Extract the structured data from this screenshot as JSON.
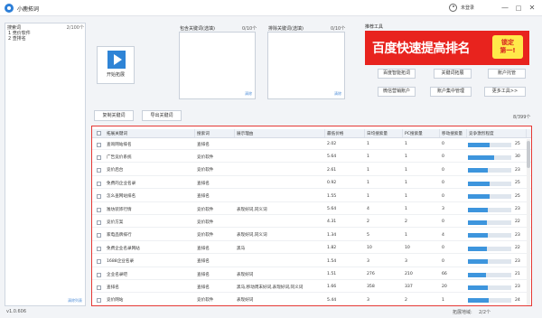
{
  "app": {
    "title": "小鹿拓词",
    "login_label": "未登录",
    "minimize_glyph": "—",
    "maximize_glyph": "□",
    "close_glyph": "✕"
  },
  "sidebar": {
    "title": "搜索词",
    "count": "2/100个",
    "items": [
      "1 竞价软件",
      "2 查排名"
    ],
    "clear_label": "清除列表"
  },
  "start_button": {
    "label": "开始拓展"
  },
  "include_kw": {
    "label": "包含关键词(选填)",
    "count": "0/10个",
    "clear_label": "清除"
  },
  "exclude_kw": {
    "label": "排除关键词(选填)",
    "count": "0/10个",
    "clear_label": "清除"
  },
  "tools": {
    "label": "推荐工具",
    "banner_text": "百度快速提高排名",
    "badge_line1": "锁定",
    "badge_line2": "第一!",
    "buttons": [
      "百度智能拓词",
      "关键词拓展",
      "账户托管",
      "微信营销账户",
      "账户集中管理",
      "更多工具>>"
    ]
  },
  "actions": {
    "copy_label": "复制关键词",
    "export_label": "导出关键词",
    "result_count": "8/399个"
  },
  "table": {
    "headers": [
      "拓展关键词",
      "搜索词",
      "展示理由",
      "最低价格",
      "日均搜索量",
      "PC搜索量",
      "移动搜索量",
      "竞争激烈程度"
    ],
    "rows": [
      {
        "kw": "查询网站排名",
        "src": "查排名",
        "reason": "",
        "price": "2.02",
        "daily": "1",
        "pc": "1",
        "mobile": "0",
        "comp": 25
      },
      {
        "kw": "广告竞价系统",
        "src": "竞价软件",
        "reason": "",
        "price": "5.64",
        "daily": "1",
        "pc": "1",
        "mobile": "0",
        "comp": 30
      },
      {
        "kw": "竞价后台",
        "src": "竞价软件",
        "reason": "",
        "price": "2.61",
        "daily": "1",
        "pc": "1",
        "mobile": "0",
        "comp": 23
      },
      {
        "kw": "免费的企业名录",
        "src": "查排名",
        "reason": "",
        "price": "0.92",
        "daily": "1",
        "pc": "1",
        "mobile": "0",
        "comp": 25
      },
      {
        "kw": "怎么查网站排名",
        "src": "查排名",
        "reason": "",
        "price": "1.55",
        "daily": "1",
        "pc": "1",
        "mobile": "0",
        "comp": 25
      },
      {
        "kw": "潍坊装饰行情",
        "src": "竞价软件",
        "reason": "表现好词,同义词",
        "price": "5.64",
        "daily": "4",
        "pc": "1",
        "mobile": "3",
        "comp": 23
      },
      {
        "kw": "竞价方案",
        "src": "竞价软件",
        "reason": "",
        "price": "4.31",
        "daily": "2",
        "pc": "2",
        "mobile": "0",
        "comp": 22
      },
      {
        "kw": "家电品牌排行",
        "src": "竞价软件",
        "reason": "表现好词,同义词",
        "price": "1.34",
        "daily": "5",
        "pc": "1",
        "mobile": "4",
        "comp": 23
      },
      {
        "kw": "免费企业名录网站",
        "src": "查排名",
        "reason": "黑马",
        "price": "1.82",
        "daily": "10",
        "pc": "10",
        "mobile": "0",
        "comp": 22
      },
      {
        "kw": "1688企业名录",
        "src": "查排名",
        "reason": "",
        "price": "1.54",
        "daily": "3",
        "pc": "3",
        "mobile": "0",
        "comp": 23
      },
      {
        "kw": "企业名录吧",
        "src": "查排名",
        "reason": "表现好词",
        "price": "1.51",
        "daily": "276",
        "pc": "210",
        "mobile": "66",
        "comp": 21
      },
      {
        "kw": "查排名",
        "src": "查排名",
        "reason": "黑马,移动周末好词,表现好词,同义词",
        "price": "1.66",
        "daily": "358",
        "pc": "337",
        "mobile": "20",
        "comp": 23
      },
      {
        "kw": "竞价网站",
        "src": "竞价软件",
        "reason": "表现好词",
        "price": "5.44",
        "daily": "3",
        "pc": "2",
        "mobile": "1",
        "comp": 24
      }
    ]
  },
  "footer": {
    "version": "v1.0.606",
    "page_label": "拓展地域:",
    "page_value": "2/2个"
  },
  "colors": {
    "accent": "#2f84d6",
    "banner_red": "#e8231e",
    "badge_yellow": "#ffe94a",
    "table_border": "#e53935",
    "bar_fill": "#3d95dd"
  }
}
